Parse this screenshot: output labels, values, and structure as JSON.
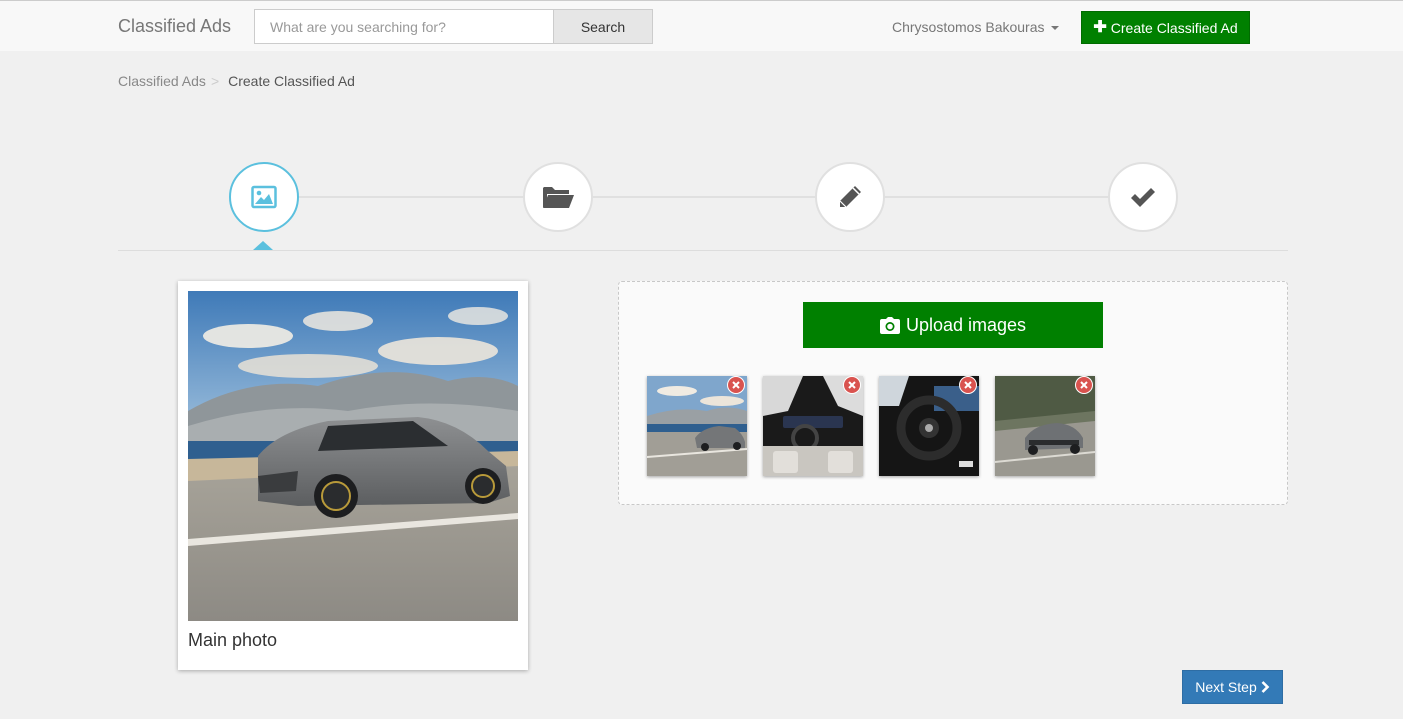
{
  "navbar": {
    "brand": "Classified Ads",
    "search_placeholder": "What are you searching for?",
    "search_button": "Search",
    "user_name": "Chrysostomos Bakouras",
    "create_button": "Create Classified Ad"
  },
  "breadcrumb": {
    "items": [
      "Classified Ads",
      "Create Classified Ad"
    ],
    "separator": ">"
  },
  "steps": {
    "active_index": 0,
    "items": [
      {
        "icon": "image-icon"
      },
      {
        "icon": "folder-open-icon"
      },
      {
        "icon": "pencil-icon"
      },
      {
        "icon": "checkmark-icon"
      }
    ]
  },
  "main_photo": {
    "label": "Main photo"
  },
  "upload": {
    "button_label": "Upload images",
    "thumbnails": [
      {
        "description": "car-coast-road"
      },
      {
        "description": "car-interior-dashboard"
      },
      {
        "description": "car-steering-wheel"
      },
      {
        "description": "car-front-driving"
      }
    ]
  },
  "footer": {
    "next_button": "Next Step"
  },
  "colors": {
    "accent": "#5bc0de",
    "success": "#008000",
    "primary": "#337ab7",
    "danger": "#d9534f"
  }
}
